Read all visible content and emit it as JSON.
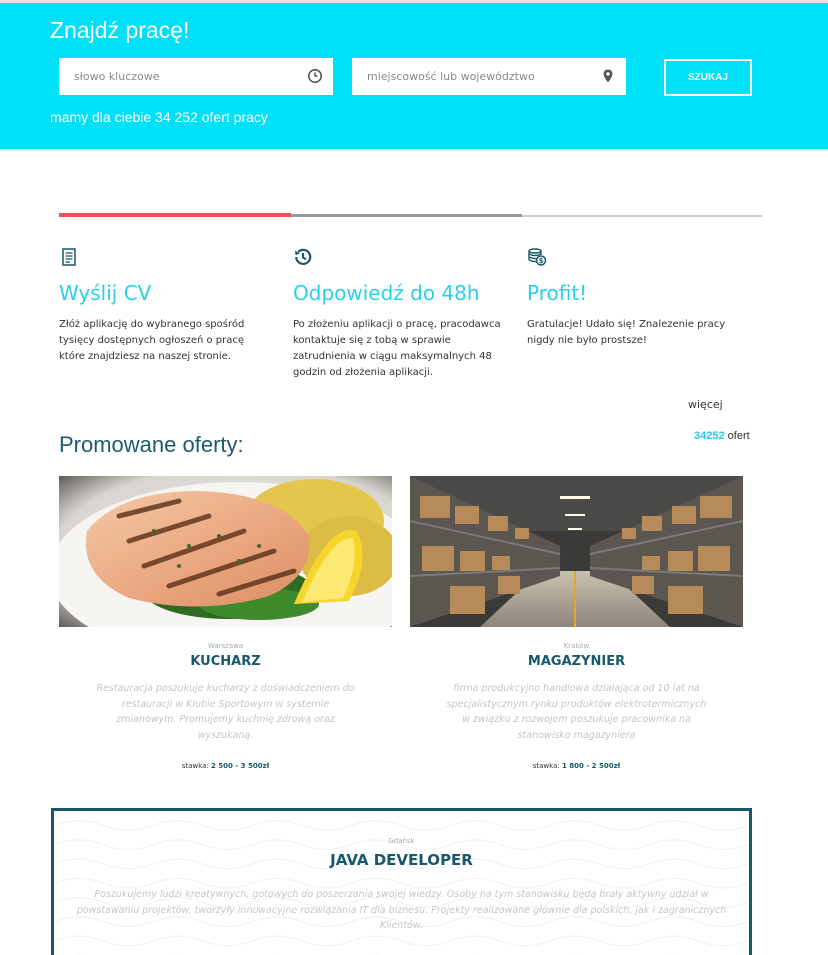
{
  "header": {
    "title": "Znajdź pracę!",
    "keyword_placeholder": "słowo kluczowe",
    "location_placeholder": "miejscowość lub województwo",
    "search_label": "SZUKAJ",
    "offers_text": "mamy dla ciebie 34 252 ofert pracy",
    "background_color": "#00e0f7",
    "keyword_icon": "clock-icon",
    "location_icon": "map-pin-icon"
  },
  "progress": {
    "colors": [
      "#f05050",
      "#999999",
      "#cfcfcf"
    ]
  },
  "steps": [
    {
      "icon": "document-icon",
      "title": "Wyślij CV",
      "text": "Złóż aplikację do wybranego spośród tysięcy dostępnych ogłoszeń o pracę które znajdziesz na naszej stronie."
    },
    {
      "icon": "history-icon",
      "title": "Odpowiedź do 48h",
      "text": "Po złożeniu aplikacji o pracę, pracodawca kontaktuje się z tobą w sprawie zatrudnienia w ciągu maksymalnych 48 godzin od złożenia aplikacji."
    },
    {
      "icon": "coins-icon",
      "title": "Profit!",
      "text": "Gratulacje! Udało się! Znalezenie pracy nigdy nie było prostsze!"
    }
  ],
  "more_link": "więcej",
  "promoted": {
    "title": "Promowane oferty:",
    "count": "34252",
    "count_suffix": "ofert"
  },
  "offers": [
    {
      "image": "grilled-salmon-photo",
      "city": "Warszawa",
      "job": "KUCHARZ",
      "description": "Restauracja poszukuje kucharzy z doświadczeniem do restauracji w Klubie Sportowym w systemie zmianowym. Promujemy kuchnię zdrową oraz wyszukaną.",
      "rate_label": "stawka:",
      "rate_value": "2 500 - 3 500zł"
    },
    {
      "image": "warehouse-photo",
      "city": "Kraków",
      "job": "MAGAZYNIER",
      "description": "firma produkcyjno handlowa działająca od 10 lat na specjalistycznym rynku produktów elektrotermicznych w związku z rozwojem poszukuje pracownika na stanowisko magazyniera",
      "rate_label": "stawka:",
      "rate_value": "1 800 - 2 500zł"
    }
  ],
  "featured": {
    "city": "Gdańsk",
    "job": "JAVA DEVELOPER",
    "description": "Poszukujemy ludzi kreatywnych, gotowych do poszerzania swojej wiedzy. Osoby na tym stanowisku będą brały aktywny udział w powstawaniu projektów, tworzyły innowacyjne rozwiązania IT dla biznesu. Projekty realizowane głównie dla polskich, jak i zagranicznych Klientów.",
    "border_color": "#17586b"
  }
}
